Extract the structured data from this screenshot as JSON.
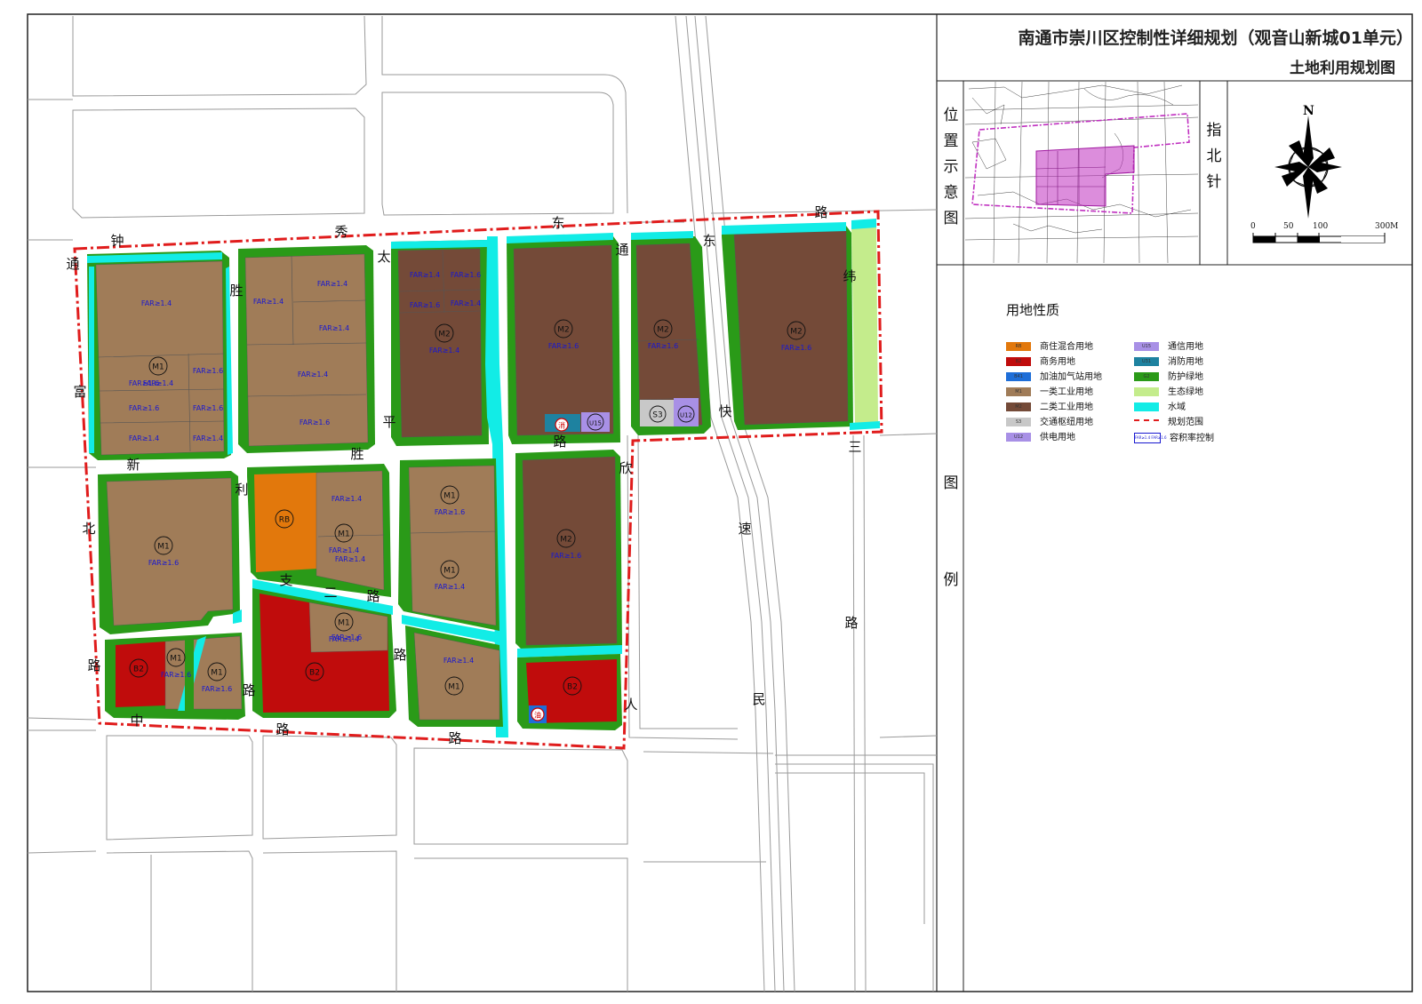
{
  "title": {
    "main": "南通市崇川区控制性详细规划（观音山新城01单元）",
    "sub": "土地利用规划图"
  },
  "side_labels": {
    "location": [
      "位",
      "置",
      "示",
      "意",
      "图"
    ],
    "compass": [
      "指",
      "北",
      "针"
    ],
    "legend": [
      "图",
      "例"
    ]
  },
  "compass": {
    "north_label": "N"
  },
  "scale": {
    "ticks": [
      "0",
      "50",
      "100",
      "300M"
    ]
  },
  "legend": {
    "title": "用地性质",
    "left": [
      {
        "code": "RB",
        "label": "商住混合用地",
        "color": "#e2780c"
      },
      {
        "code": "B2",
        "label": "商务用地",
        "color": "#c00c0c"
      },
      {
        "code": "B41",
        "label": "加油加气站用地",
        "color": "#1e6ed8"
      },
      {
        "code": "M1",
        "label": "一类工业用地",
        "color": "#a07c58"
      },
      {
        "code": "M2",
        "label": "二类工业用地",
        "color": "#744a38"
      },
      {
        "code": "S3",
        "label": "交通枢纽用地",
        "color": "#c8c8c8"
      },
      {
        "code": "U12",
        "label": "供电用地",
        "color": "#a890e6"
      }
    ],
    "right": [
      {
        "code": "U15",
        "label": "通信用地",
        "color": "#a890e6"
      },
      {
        "code": "U31",
        "label": "消防用地",
        "color": "#1e82a0"
      },
      {
        "code": "G2",
        "label": "防护绿地",
        "color": "#2a9a18"
      },
      {
        "code": "",
        "label": "生态绿地",
        "color": "#c4ec8c"
      },
      {
        "code": "",
        "label": "水域",
        "color": "#12ece6"
      },
      {
        "code": "",
        "label": "规划范围",
        "color": "#e01c1c"
      },
      {
        "code": "FAR≥1.4 FAR≥1.6",
        "label": "容积率控制",
        "color": "#ffffff"
      }
    ]
  },
  "parcels": [
    {
      "code": "M1",
      "far": "FAR≥1.4"
    },
    {
      "code": "M1",
      "far": "FAR≥1.6"
    },
    {
      "code": "M2",
      "far": "FAR≥1.4"
    },
    {
      "code": "M2",
      "far": "FAR≥1.6"
    },
    {
      "code": "M2",
      "far": "FAR≥1.6"
    },
    {
      "code": "M2",
      "far": "FAR≥1.6"
    },
    {
      "code": "M1",
      "far": "FAR≥1.6"
    },
    {
      "code": "RB",
      "far": ""
    },
    {
      "code": "M1",
      "far": "FAR≥1.4"
    },
    {
      "code": "M1",
      "far": "FAR≥1.6"
    },
    {
      "code": "M1",
      "far": "FAR≥1.4"
    },
    {
      "code": "M2",
      "far": "FAR≥1.6"
    },
    {
      "code": "B2",
      "far": ""
    },
    {
      "code": "M1",
      "far": "FAR≥1.6"
    },
    {
      "code": "M1",
      "far": "FAR≥1.6"
    },
    {
      "code": "B2",
      "far": ""
    },
    {
      "code": "M1",
      "far": "FAR≥1.4"
    },
    {
      "code": "M1",
      "far": ""
    },
    {
      "code": "B2",
      "far": ""
    },
    {
      "code": "S3",
      "far": ""
    },
    {
      "code": "U12",
      "far": ""
    },
    {
      "code": "U15",
      "far": ""
    }
  ],
  "far_labels": [
    "FAR≥1.4",
    "FAR≥1.6",
    "FAR≥1.6",
    "FAR≥1.4",
    "FAR≥1.6",
    "FAR≥1.6",
    "FAR≥1.4",
    "FAR≥1.4",
    "FAR≥1.4",
    "FAR≥1.4",
    "FAR≥1.4",
    "FAR≥1.6",
    "FAR≥1.4",
    "FAR≥1.6",
    "FAR≥1.6",
    "FAR≥1.4",
    "FAR≥1.4",
    "FAR≥1.4",
    "FAR≥1.6",
    "FAR≥1.4"
  ],
  "facility_labels": [
    "消",
    "油"
  ],
  "road_chars": [
    "钟",
    "秀",
    "东",
    "路",
    "通",
    "胜",
    "太",
    "通",
    "东",
    "纬",
    "富",
    "平",
    "快",
    "三",
    "新",
    "胜",
    "路",
    "欣",
    "利",
    "北",
    "支",
    "二",
    "路",
    "速",
    "路",
    "路",
    "路",
    "路",
    "人",
    "民",
    "中",
    "路",
    "路"
  ]
}
